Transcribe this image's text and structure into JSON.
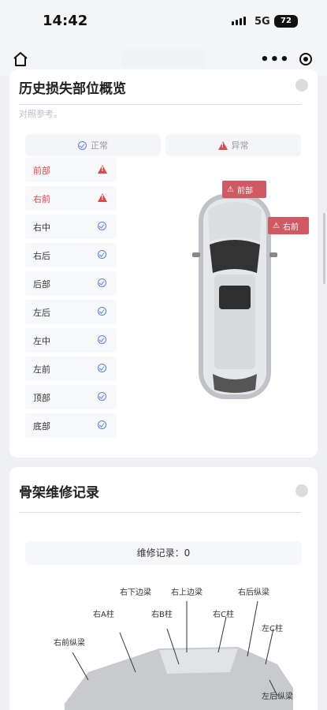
{
  "status_bar": {
    "time": "14:42",
    "network": "5G",
    "battery": "72"
  },
  "nav": {
    "home_icon": "home-icon",
    "more_icon": "more-dots-icon",
    "close_icon": "close-ring-icon"
  },
  "damage_overview": {
    "title": "历史损失部位概览",
    "subtitle": "对照参考。",
    "legend": {
      "normal": "正常",
      "abnormal": "异常"
    },
    "parts": [
      {
        "label": "前部",
        "status": "damaged"
      },
      {
        "label": "右前",
        "status": "damaged"
      },
      {
        "label": "右中",
        "status": "normal"
      },
      {
        "label": "右后",
        "status": "normal"
      },
      {
        "label": "后部",
        "status": "normal"
      },
      {
        "label": "左后",
        "status": "normal"
      },
      {
        "label": "左中",
        "status": "normal"
      },
      {
        "label": "左前",
        "status": "normal"
      },
      {
        "label": "顶部",
        "status": "normal"
      },
      {
        "label": "底部",
        "status": "normal"
      }
    ],
    "car_tags": [
      "前部",
      "右前"
    ]
  },
  "frame_repair": {
    "title": "骨架维修记录",
    "count_text": "维修记录：0",
    "frame_labels": [
      "右下边梁",
      "右上边梁",
      "右后纵梁",
      "右A柱",
      "右B柱",
      "右C柱",
      "左C柱",
      "右前纵梁",
      "左后纵梁"
    ]
  },
  "colors": {
    "accent_blue": "#5a7ee8",
    "danger_red": "#e04646",
    "tag_red": "#d05a63"
  }
}
